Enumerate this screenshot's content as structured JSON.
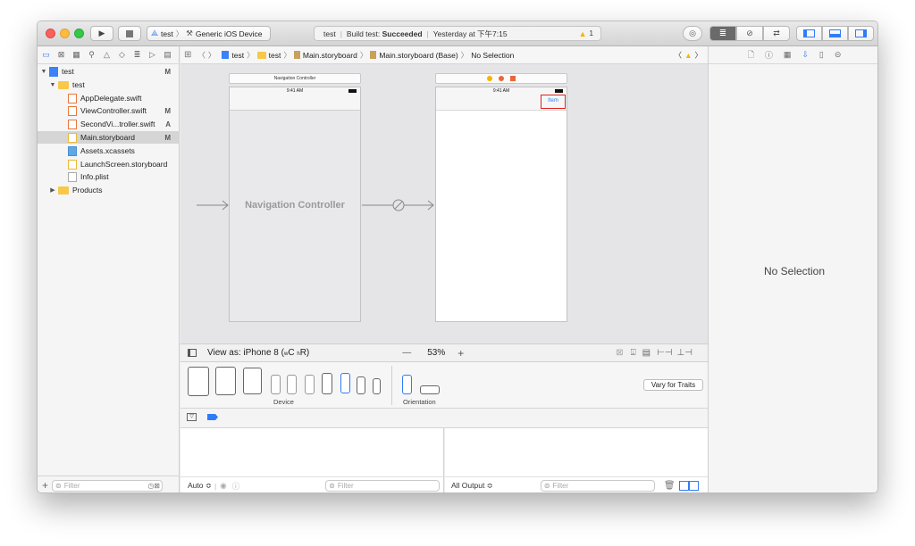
{
  "toolbar": {
    "scheme_target": "test",
    "scheme_device": "Generic iOS Device",
    "activity_project": "test",
    "activity_status_prefix": "Build test:",
    "activity_status": "Succeeded",
    "activity_time": "Yesterday at 下午7:15",
    "warning_count": "1"
  },
  "navigator": {
    "items": [
      {
        "label": "test",
        "badge": "M"
      },
      {
        "label": "test",
        "badge": ""
      },
      {
        "label": "AppDelegate.swift",
        "badge": ""
      },
      {
        "label": "ViewController.swift",
        "badge": "M"
      },
      {
        "label": "SecondVi...troller.swift",
        "badge": "A"
      },
      {
        "label": "Main.storyboard",
        "badge": "M"
      },
      {
        "label": "Assets.xcassets",
        "badge": ""
      },
      {
        "label": "LaunchScreen.storyboard",
        "badge": ""
      },
      {
        "label": "Info.plist",
        "badge": ""
      },
      {
        "label": "Products",
        "badge": ""
      }
    ],
    "filter_placeholder": "Filter"
  },
  "jumpbar": {
    "crumbs": [
      "test",
      "test",
      "Main.storyboard",
      "Main.storyboard (Base)",
      "No Selection"
    ]
  },
  "canvas": {
    "nav_scene_title": "Navigation Controller",
    "nav_status_time": "9:41 AM",
    "nav_label": "Navigation Controller",
    "vc_status_time": "9:41 AM",
    "vc_bar_item": "Item"
  },
  "canvasbar": {
    "view_as": "View as: iPhone 8 (",
    "size_class_w": "w",
    "size_class_c": "C",
    "size_class_h": "h",
    "size_class_r": "R)",
    "zoom": "53%",
    "zoom_out": "—",
    "zoom_in": "+"
  },
  "devicebar": {
    "device_label": "Device",
    "orientation_label": "Orientation",
    "vary_button": "Vary for Traits"
  },
  "debug": {
    "auto_label": "Auto ≎",
    "all_output_label": "All Output ≎",
    "filter_placeholder": "Filter"
  },
  "inspector": {
    "no_selection": "No Selection"
  },
  "colors": {
    "accent": "#2f7cf6",
    "warning": "#f5b400",
    "highlight_box": "#e0211b"
  }
}
